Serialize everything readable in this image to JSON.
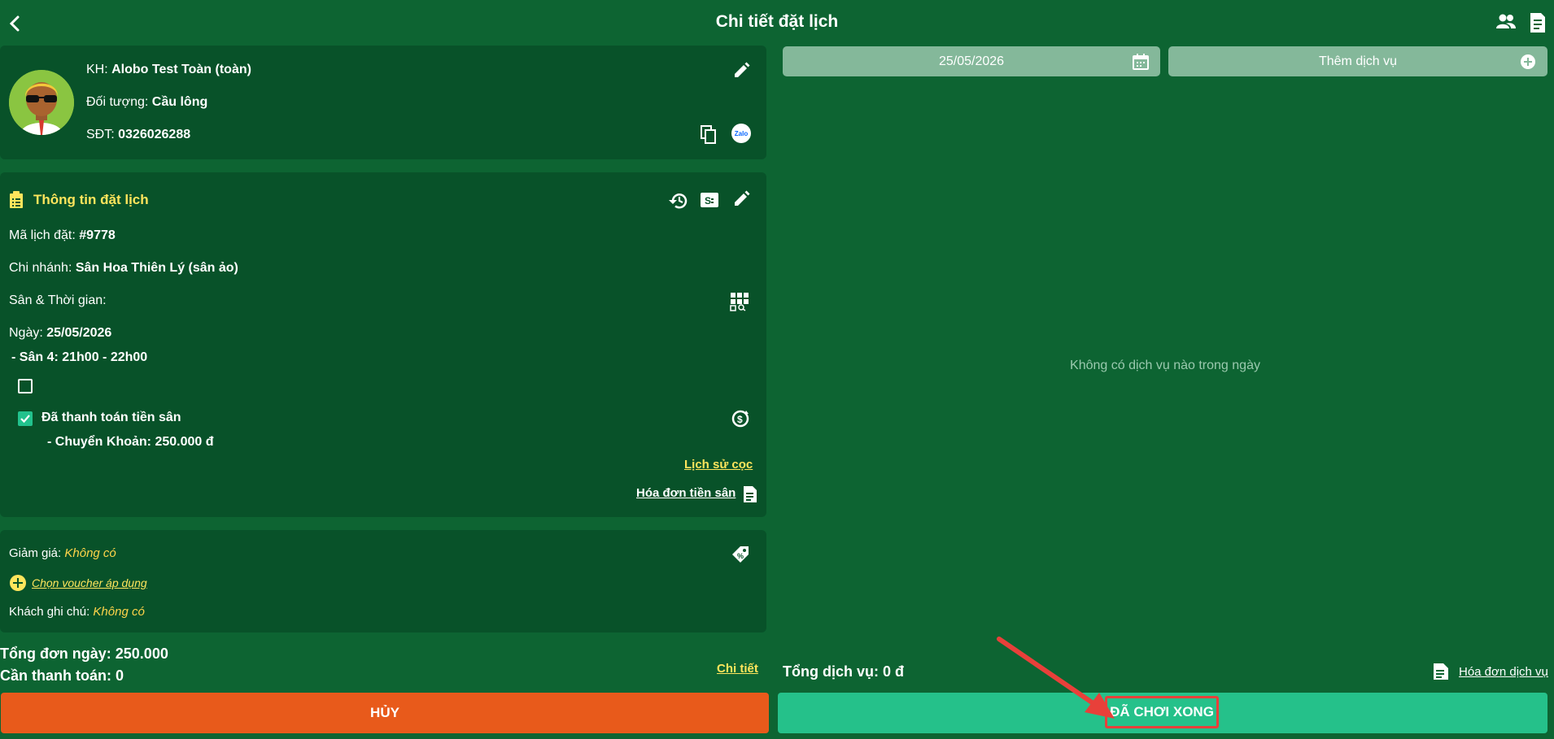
{
  "header": {
    "title": "Chi tiết đặt lịch"
  },
  "customer": {
    "name_label": "KH:",
    "name_value": "Alobo Test Toàn (toàn)",
    "target_label": "Đối tượng:",
    "target_value": "Cầu lông",
    "phone_label": "SĐT:",
    "phone_value": "0326026288",
    "zalo_text": "Zalo"
  },
  "booking": {
    "section_title": "Thông tin đặt lịch",
    "code_label": "Mã lịch đặt:",
    "code_value": "#9778",
    "branch_label": "Chi nhánh:",
    "branch_value": "Sân Hoa Thiên Lý (sân ảo)",
    "court_time_label": "Sân & Thời gian:",
    "date_label": "Ngày:",
    "date_value": "25/05/2026",
    "court_line": "- Sân 4: 21h00 - 22h00",
    "paid_label": "Đã thanh toán tiền sân",
    "payment_line": "- Chuyển Khoản: 250.000 đ",
    "deposit_history_link": "Lịch sử cọc",
    "invoice_link": "Hóa đơn tiền sân"
  },
  "discount": {
    "discount_label": "Giảm giá:",
    "discount_value": "Không có",
    "voucher_link": "Chọn voucher áp dụng",
    "note_label": "Khách ghi chú:",
    "note_value": "Không có"
  },
  "totals": {
    "day_total": "Tổng đơn ngày: 250.000",
    "to_pay": "Cần thanh toán: 0",
    "detail_link": "Chi tiết"
  },
  "services": {
    "date": "25/05/2026",
    "add_service_label": "Thêm dịch vụ",
    "empty_text": "Không có dịch vụ nào trong ngày",
    "total": "Tổng dịch vụ: 0 đ",
    "invoice_link": "Hóa đơn dịch vụ"
  },
  "actions": {
    "cancel_label": "HỦY",
    "done_label": "ĐÃ CHƠI XONG"
  },
  "colors": {
    "background": "#0d6432",
    "card": "#085229",
    "accent_yellow": "#ffe55c",
    "cancel": "#e85a1b",
    "done": "#25c18a",
    "highlight": "#e8403a"
  }
}
